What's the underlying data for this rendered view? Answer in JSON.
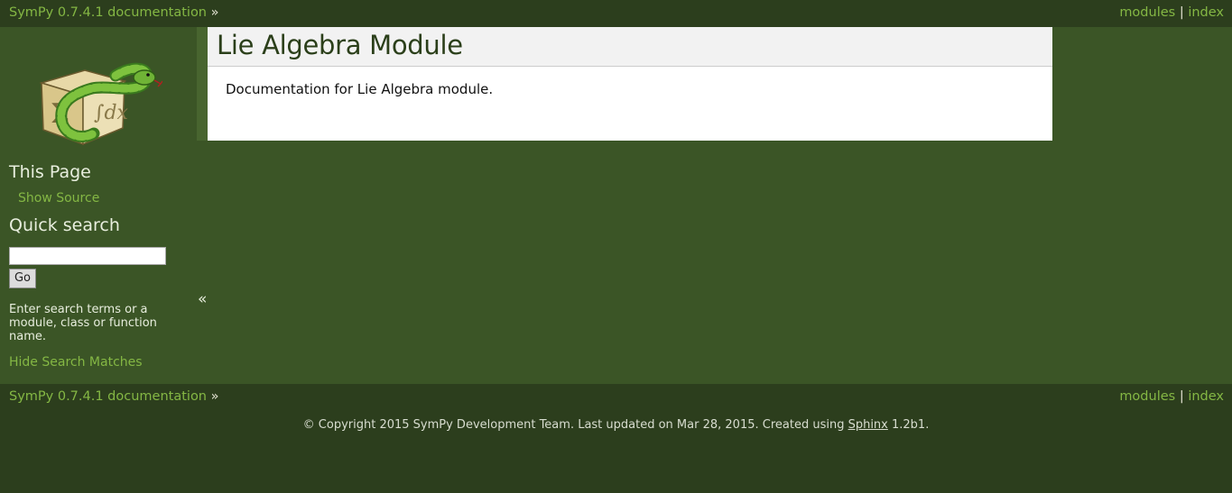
{
  "relbar": {
    "home_link": "SymPy 0.7.4.1 documentation",
    "chevron": "»",
    "modules_link": "modules",
    "separator": "|",
    "index_link": "index"
  },
  "sidebar": {
    "logo_icon": "sympy-logo-icon",
    "this_page_heading": "This Page",
    "show_source_link": "Show Source",
    "quick_search_heading": "Quick search",
    "search_value": "",
    "go_button": "Go",
    "search_hint": "Enter search terms or a module, class or function name.",
    "hide_matches_link": "Hide Search Matches",
    "collapse_glyph": "«"
  },
  "content": {
    "title": "Lie Algebra Module",
    "body": "Documentation for Lie Algebra module."
  },
  "footer": {
    "copyright_prefix": "© Copyright 2015 SymPy Development Team. Last updated on Mar 28, 2015. Created using ",
    "sphinx_link": "Sphinx",
    "version_suffix": " 1.2b1."
  },
  "colors": {
    "background": "#3b5526",
    "relbar": "#2c3e1d",
    "link": "#84b744",
    "title": "#2b3f1a"
  }
}
